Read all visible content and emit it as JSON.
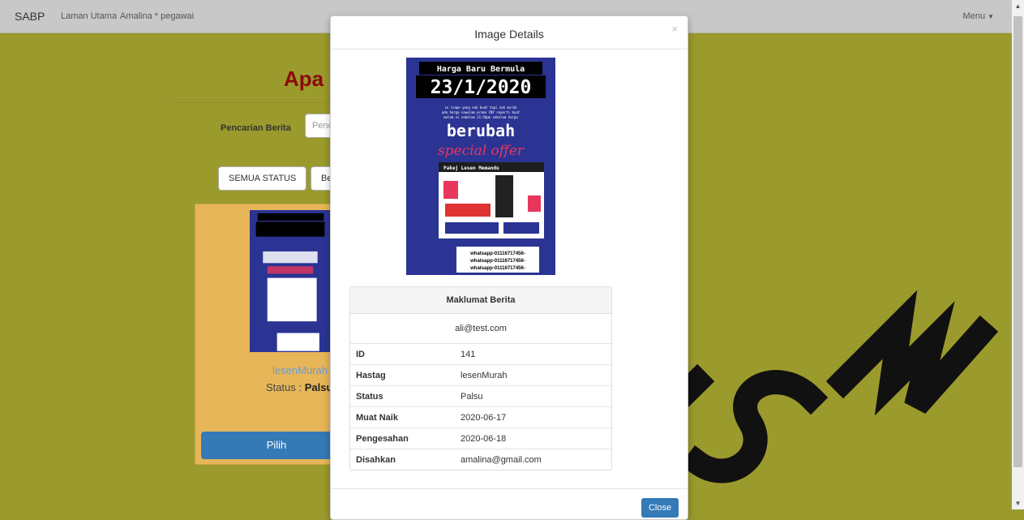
{
  "navbar": {
    "brand": "SABP",
    "links": [
      "Laman Utama",
      "Amalina * pegawai"
    ],
    "menu_label": "Menu"
  },
  "page": {
    "title": "Apa",
    "search_label": "Pencarian Berita",
    "search_placeholder": "Penc",
    "status_buttons": [
      "SEMUA STATUS",
      "Be"
    ]
  },
  "card": {
    "hashtag": "lesenMurah",
    "status_label": "Status :",
    "status_value": "Palsu",
    "select_label": "Pilih"
  },
  "poster": {
    "headline": "Harga Baru Bermula",
    "date": "23/1/2020",
    "blurb_lines": [
      "so ziape yang nak buat tapi nak murah",
      "ada harga sewalam promo CNY ceperti buat",
      "malam ni sebelum 11:50pm sebelum harga"
    ],
    "big_word": "berubah",
    "script_text": "special offer",
    "panel_title": "Pakej Lesen Memandu",
    "contact_lines": [
      "whatsapp-01116717456-",
      "whatsapp-01116717456-",
      "whatsapp-01116717456-"
    ],
    "colors": {
      "background": "#2b3493",
      "accent": "#e8365d"
    }
  },
  "modal": {
    "title": "Image Details",
    "close_icon": "×",
    "table_header": "Maklumat Berita",
    "submitter_email": "ali@test.com",
    "rows": [
      {
        "key": "ID",
        "value": "141"
      },
      {
        "key": "Hastag",
        "value": "lesenMurah"
      },
      {
        "key": "Status",
        "value": "Palsu"
      },
      {
        "key": "Muat Naik",
        "value": "2020-06-17"
      },
      {
        "key": "Pengesahan",
        "value": "2020-06-18"
      },
      {
        "key": "Disahkan",
        "value": "amalina@gmail.com"
      }
    ],
    "close_label": "Close"
  },
  "watermark": {
    "text": "TSM",
    "color": "#111111"
  }
}
